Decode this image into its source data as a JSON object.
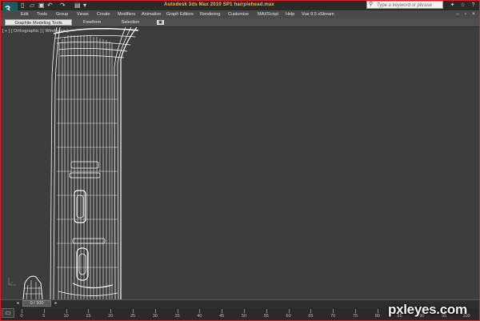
{
  "window": {
    "title": "Autodesk 3ds Max  2010 SP1     hairpiehead.max",
    "search_placeholder": "Type a keyword or phrase",
    "app_logo_glyph": "3"
  },
  "menu": {
    "items": [
      "Edit",
      "Tools",
      "Group",
      "Views",
      "Create",
      "Modifiers",
      "Animation",
      "Graph Editors",
      "Rendering",
      "Customize",
      "MAXScript",
      "Help",
      "Vue 9.5 xStream"
    ],
    "window_buttons": [
      "–",
      "▫",
      "×"
    ]
  },
  "ribbon": {
    "tabs": [
      "Graphite Modeling Tools",
      "Freeform",
      "Selection"
    ],
    "active_tab": "Graphite Modeling Tools",
    "toggle_glyph": "▣"
  },
  "viewport": {
    "label": "[ + ] [ Orthographic ] [ Wireframe ]"
  },
  "timeline": {
    "frame_readout": "0 / 100",
    "ticks": [
      "0",
      "5",
      "10",
      "15",
      "20",
      "25",
      "30",
      "35",
      "40",
      "45",
      "50",
      "55",
      "60",
      "65",
      "70",
      "75",
      "80",
      "85",
      "90",
      "95",
      "100"
    ]
  },
  "watermark": {
    "text": "pxleyes.com"
  },
  "colors": {
    "frame_border": "#c8282c",
    "title_text": "#e8b86a",
    "viewport_bg": "#3d3d3d",
    "wireframe": "#ffffff"
  }
}
